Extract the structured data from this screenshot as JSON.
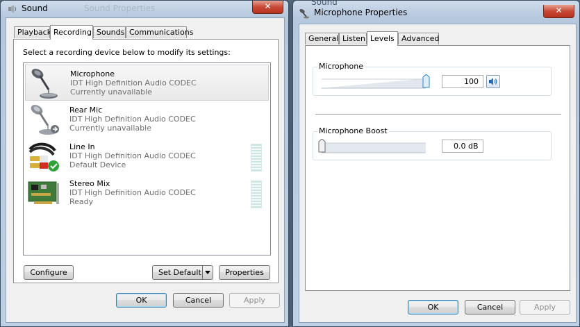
{
  "sound_window": {
    "title": "Sound",
    "ghost_title": "Sound Properties",
    "close_label": "✕",
    "tabs": [
      {
        "label": "Playback"
      },
      {
        "label": "Recording"
      },
      {
        "label": "Sounds"
      },
      {
        "label": "Communications"
      }
    ],
    "instruction": "Select a recording device below to modify its settings:",
    "devices": [
      {
        "name": "Microphone",
        "driver": "IDT High Definition Audio CODEC",
        "status": "Currently unavailable",
        "selected": true,
        "icon": "microphone-icon"
      },
      {
        "name": "Rear Mic",
        "driver": "IDT High Definition Audio CODEC",
        "status": "Currently unavailable",
        "icon": "microphone-unplugged-icon"
      },
      {
        "name": "Line In",
        "driver": "IDT High Definition Audio CODEC",
        "status": "Default Device",
        "icon": "rca-cable-icon"
      },
      {
        "name": "Stereo Mix",
        "driver": "IDT High Definition Audio CODEC",
        "status": "Ready",
        "icon": "sound-card-icon"
      }
    ],
    "buttons": {
      "configure": "Configure",
      "set_default": "Set Default",
      "properties": "Properties",
      "ok": "OK",
      "cancel": "Cancel",
      "apply": "Apply"
    }
  },
  "mic_props_window": {
    "title": "Microphone Properties",
    "background_title": "Sound",
    "close_label": "✕",
    "tabs": [
      {
        "label": "General"
      },
      {
        "label": "Listen"
      },
      {
        "label": "Levels"
      },
      {
        "label": "Advanced"
      }
    ],
    "microphone_group": {
      "label": "Microphone",
      "value": "100",
      "level": 1.0
    },
    "boost_group": {
      "label": "Microphone Boost",
      "value": "0.0 dB",
      "level": 0.0
    },
    "buttons": {
      "ok": "OK",
      "cancel": "Cancel",
      "apply": "Apply"
    }
  },
  "colors": {
    "accent_blue": "#3c7fb1",
    "check_green": "#2fa33a",
    "close_red": "#c74a36"
  }
}
